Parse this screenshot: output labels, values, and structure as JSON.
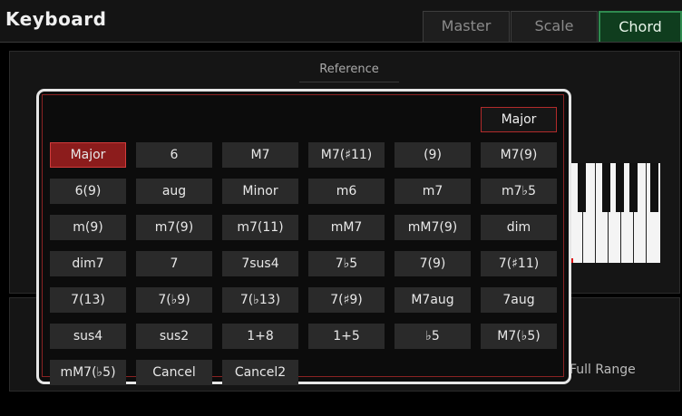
{
  "header": {
    "title": "Keyboard",
    "tabs": [
      {
        "label": "Master",
        "active": false
      },
      {
        "label": "Scale",
        "active": false
      },
      {
        "label": "Chord",
        "active": true
      }
    ]
  },
  "reference": {
    "label": "Reference"
  },
  "full_range_label": "Full Range",
  "chord_dialog": {
    "current_chord": "Major",
    "selected_chord": "Major",
    "chords": [
      [
        "Major",
        "6",
        "M7",
        "M7(♯11)",
        "(9)",
        "M7(9)"
      ],
      [
        "6(9)",
        "aug",
        "Minor",
        "m6",
        "m7",
        "m7♭5"
      ],
      [
        "m(9)",
        "m7(9)",
        "m7(11)",
        "mM7",
        "mM7(9)",
        "dim"
      ],
      [
        "dim7",
        "7",
        "7sus4",
        "7♭5",
        "7(9)",
        "7(♯11)"
      ],
      [
        "7(13)",
        "7(♭9)",
        "7(♭13)",
        "7(♯9)",
        "M7aug",
        "7aug"
      ],
      [
        "sus4",
        "sus2",
        "1+8",
        "1+5",
        "♭5",
        "M7(♭5)"
      ],
      [
        "mM7(♭5)",
        "Cancel",
        "Cancel2"
      ]
    ]
  },
  "colors": {
    "accent_green": "#2f8a4f",
    "selected_red": "#8c1c1c",
    "dialog_border": "#e6e6e6"
  }
}
